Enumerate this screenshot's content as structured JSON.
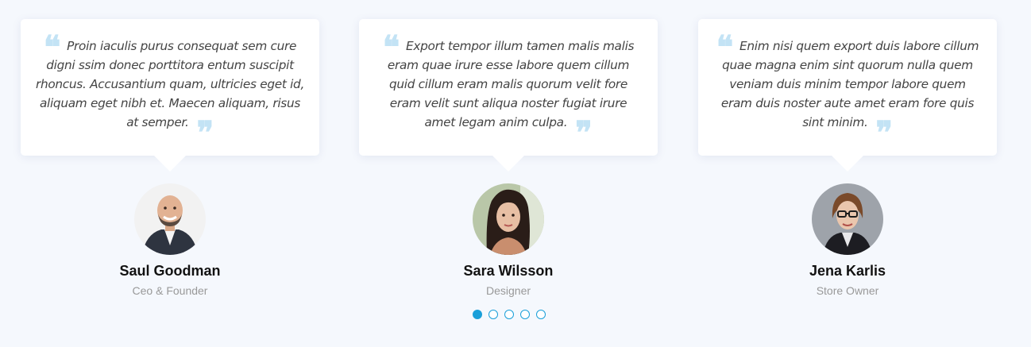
{
  "testimonials": [
    {
      "text": "Proin iaculis purus consequat sem cure digni ssim donec porttitora entum suscipit rhoncus. Accusantium quam, ultricies eget id, aliquam eget nibh et. Maecen aliquam, risus at semper.",
      "name": "Saul Goodman",
      "role": "Ceo & Founder"
    },
    {
      "text": "Export tempor illum tamen malis malis eram quae irure esse labore quem cillum quid cillum eram malis quorum velit fore eram velit sunt aliqua noster fugiat irure amet legam anim culpa.",
      "name": "Sara Wilsson",
      "role": "Designer"
    },
    {
      "text": "Enim nisi quem export duis labore cillum quae magna enim sint quorum nulla quem veniam duis minim tempor labore quem eram duis noster aute amet eram fore quis sint minim.",
      "name": "Jena Karlis",
      "role": "Store Owner"
    }
  ],
  "quote_open": "❝",
  "quote_close": "❞",
  "pagination": {
    "total": 5,
    "active_index": 0
  },
  "colors": {
    "accent": "#1a9fd9",
    "quote_icon": "#c3e3f5",
    "background": "#f5f8fd"
  }
}
